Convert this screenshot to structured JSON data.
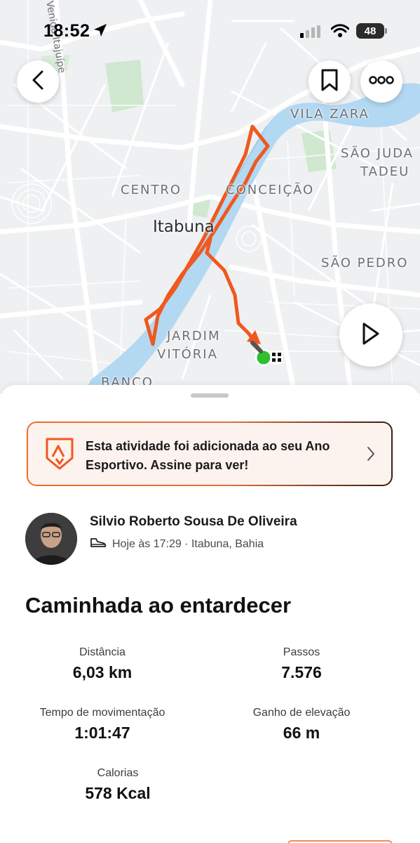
{
  "status_bar": {
    "time": "18:52",
    "battery": "48"
  },
  "map": {
    "city": "Itabuna",
    "street": "Venida Itajuípe",
    "neighborhoods": {
      "vila_zara": "VILA ZARA",
      "sao_juda": "SÃO JUDA",
      "tadeu": "TADEU",
      "centro": "CENTRO",
      "conceicao": "CONCEIÇÃO",
      "sao_pedro": "SÃO PEDRO",
      "jardim": "JARDIM",
      "vitoria": "VITÓRIA",
      "banco": "BANCO"
    },
    "route_color": "#f0581f",
    "river_color": "#b2d8f2"
  },
  "promo": {
    "text": "Esta atividade foi adicionada ao seu Ano Esportivo. Assine para ver!"
  },
  "athlete": {
    "name": "Silvio Roberto Sousa De Oliveira",
    "meta": "Hoje às 17:29 · Itabuna, Bahia"
  },
  "activity": {
    "title": "Caminhada ao entardecer"
  },
  "stats": [
    {
      "label": "Distância",
      "value": "6,03 km"
    },
    {
      "label": "Passos",
      "value": "7.576"
    },
    {
      "label": "Tempo de movimentação",
      "value": "1:01:47"
    },
    {
      "label": "Ganho de elevação",
      "value": "66 m"
    },
    {
      "label": "Calorias",
      "value": "578 Kcal"
    }
  ]
}
